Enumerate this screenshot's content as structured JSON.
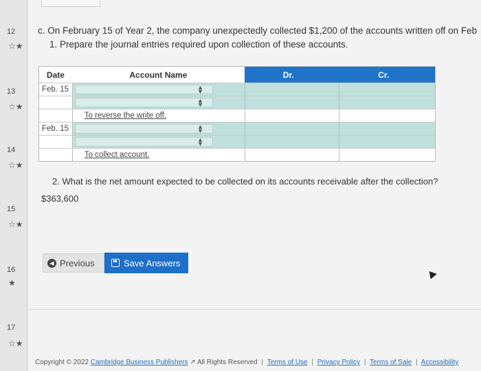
{
  "rail": {
    "questions": [
      {
        "num": "12",
        "star": "☆★"
      },
      {
        "num": "13",
        "star": "☆★"
      },
      {
        "num": "14",
        "star": "☆★"
      },
      {
        "num": "15",
        "star": "☆★"
      },
      {
        "num": "16",
        "star": "★"
      },
      {
        "num": "17",
        "star": "☆★"
      }
    ]
  },
  "question": {
    "line1": "c. On February 15 of Year 2, the company unexpectedly collected $1,200 of the accounts written off on Feb",
    "line2": "1. Prepare the journal entries required upon collection of these accounts."
  },
  "table": {
    "headers": {
      "date": "Date",
      "account": "Account Name",
      "dr": "Dr.",
      "cr": "Cr."
    },
    "rows": [
      {
        "date": "Feb. 15",
        "type": "entry"
      },
      {
        "date": "",
        "type": "entry"
      },
      {
        "date": "",
        "type": "note",
        "note": "To reverse the write off."
      },
      {
        "date": "Feb. 15",
        "type": "entry"
      },
      {
        "date": "",
        "type": "entry"
      },
      {
        "date": "",
        "type": "note",
        "note": "To collect account."
      }
    ]
  },
  "q2": {
    "text": "2. What is the net amount expected to be collected on its accounts receivable after the collection?",
    "answer": "$363,600"
  },
  "buttons": {
    "previous": "Previous",
    "save": "Save Answers"
  },
  "footer": {
    "copyright": "Copyright © 2022",
    "publisher": "Cambridge Business Publishers",
    "rights": "All Rights Reserved",
    "links": [
      "Terms of Use",
      "Privacy Policy",
      "Terms of Sale",
      "Accessibility"
    ]
  },
  "colors": {
    "accent": "#1f74c9",
    "input_bg": "#bfe0dc"
  }
}
